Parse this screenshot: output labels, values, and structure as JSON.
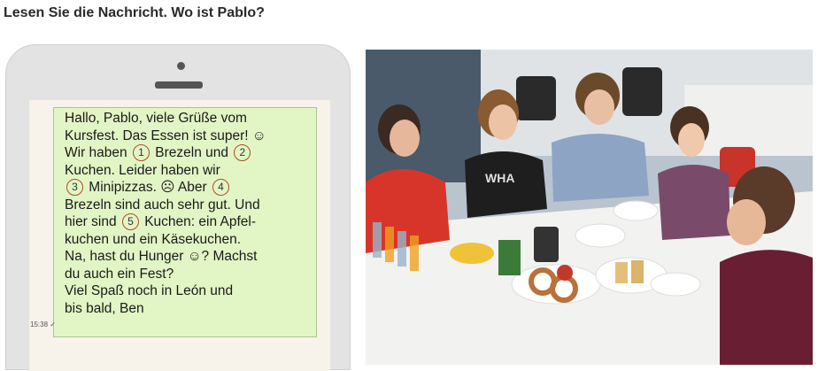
{
  "heading": "Lesen Sie die Nachricht. Wo ist Pablo?",
  "message": {
    "lines": [
      [
        {
          "t": "Hallo, Pablo, viele Grüße vom"
        }
      ],
      [
        {
          "t": "Kursfest. Das Essen ist super! ☺"
        }
      ],
      [
        {
          "t": "Wir haben "
        },
        {
          "n": "1"
        },
        {
          "t": " Brezeln und "
        },
        {
          "n": "2"
        }
      ],
      [
        {
          "t": "Kuchen. Leider haben wir"
        }
      ],
      [
        {
          "n": "3"
        },
        {
          "t": " Minipizzas. ☹ Aber "
        },
        {
          "n": "4"
        }
      ],
      [
        {
          "t": "Brezeln sind auch sehr gut. Und"
        }
      ],
      [
        {
          "t": "hier sind "
        },
        {
          "n": "5"
        },
        {
          "t": " Kuchen: ein Apfel-"
        }
      ],
      [
        {
          "t": "kuchen und ein Käsekuchen."
        }
      ],
      [
        {
          "t": "Na, hast du Hunger ☺? Machst"
        }
      ],
      [
        {
          "t": "du auch ein Fest?"
        }
      ],
      [
        {
          "t": "Viel Spaß noch in León und"
        }
      ],
      [
        {
          "t": "bis bald, Ben"
        }
      ]
    ],
    "time": "15:38 ✓"
  },
  "photo": {
    "shirt_text": "WHA"
  },
  "colors": {
    "bubble": "#e2f5c5",
    "number_circle": "#b04a2a"
  }
}
